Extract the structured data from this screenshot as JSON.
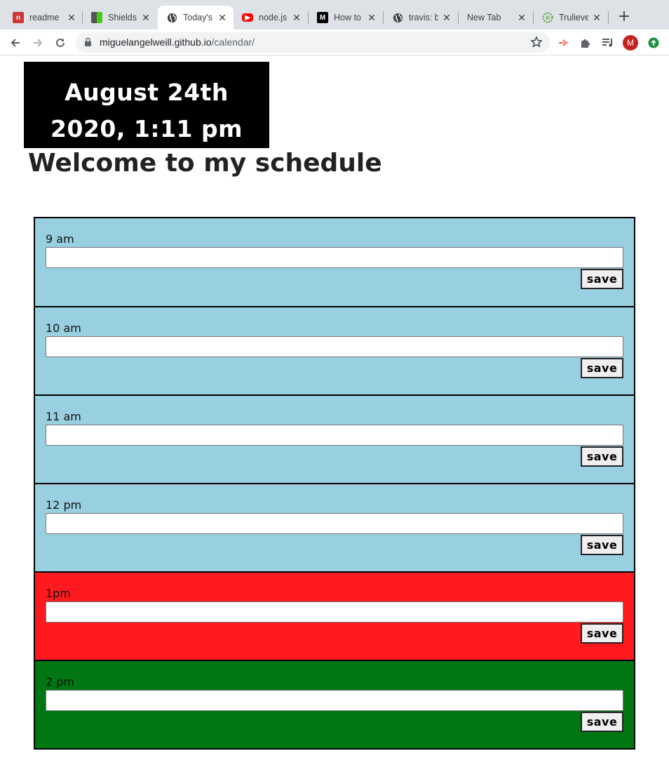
{
  "browser": {
    "tabs": [
      {
        "title": "readme",
        "favicon": "npm-icon",
        "color": "#cb3837"
      },
      {
        "title": "Shields",
        "favicon": "shields-icon",
        "color": "#4c1"
      },
      {
        "title": "Today's",
        "favicon": "globe-icon",
        "color": "#3c4043"
      },
      {
        "title": "node.js",
        "favicon": "youtube-icon",
        "color": "#ff0000"
      },
      {
        "title": "How to",
        "favicon": "medium-icon",
        "color": "#000000"
      },
      {
        "title": "travis: b",
        "favicon": "globe-icon",
        "color": "#3c4043"
      },
      {
        "title": "New Tab",
        "favicon": "",
        "color": ""
      },
      {
        "title": "Trulieve",
        "favicon": "trulieve-icon",
        "color": "#5aa02c"
      }
    ],
    "active_tab": 2,
    "url_host": "miguelangelweill.github.io",
    "url_path": "/calendar/",
    "profile_initial": "M"
  },
  "page": {
    "date_line1": "August 24th",
    "date_line2": "2020, 1:11 pm",
    "heading": "Welcome to my schedule",
    "save_label": "save",
    "hours": [
      {
        "label": "9 am",
        "state": "past",
        "value": ""
      },
      {
        "label": "10 am",
        "state": "past",
        "value": ""
      },
      {
        "label": "11 am",
        "state": "past",
        "value": ""
      },
      {
        "label": "12 pm",
        "state": "past",
        "value": ""
      },
      {
        "label": "1pm",
        "state": "present",
        "value": ""
      },
      {
        "label": "2 pm",
        "state": "future",
        "value": ""
      }
    ]
  },
  "colors": {
    "past": "#98d0e2",
    "present": "#ff1a1f",
    "future": "#007712"
  }
}
